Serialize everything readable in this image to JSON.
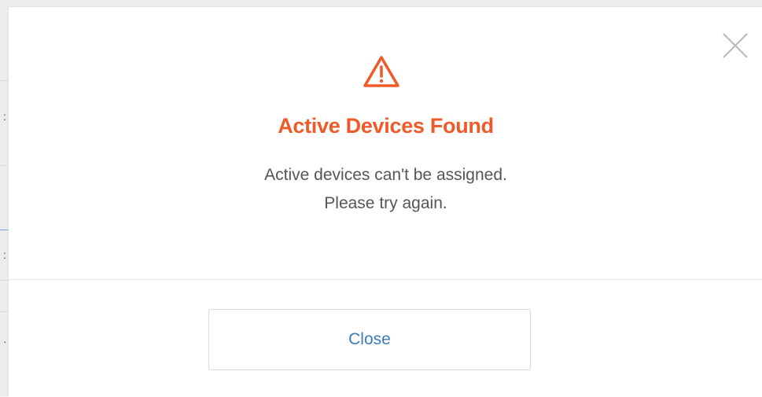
{
  "modal": {
    "title": "Active Devices Found",
    "message_line1": "Active devices can't be assigned.",
    "message_line2": "Please try again.",
    "close_button_label": "Close",
    "icons": {
      "warning": "warning-triangle-icon",
      "close": "close-icon"
    },
    "colors": {
      "title": "#f05a28",
      "warning_icon": "#f05a28",
      "close_button_text": "#3a7bb8"
    }
  }
}
